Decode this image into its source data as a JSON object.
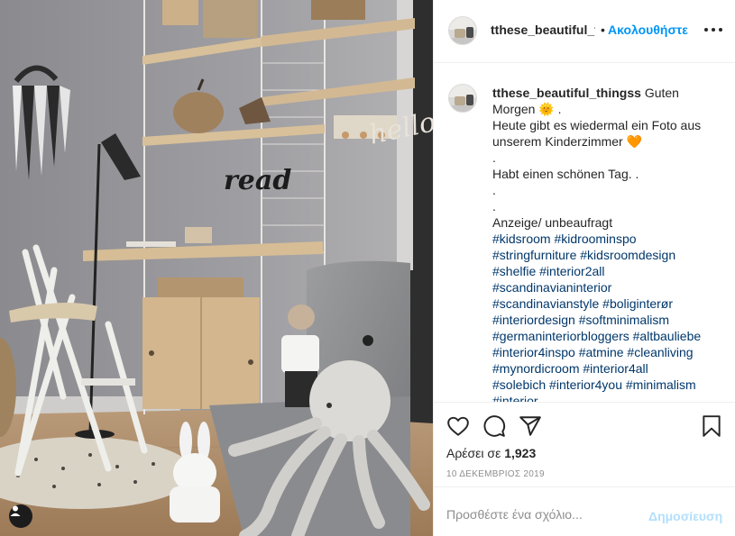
{
  "post": {
    "username": "tthese_beautiful_thingss",
    "header_username": "tthese_beautiful_tl",
    "header_separator": "•",
    "follow_label": "Ακολουθήστε",
    "caption_greeting": "Guten Morgen",
    "caption_lines": [
      "Morgen 🌞 .",
      "Heute gibt es wiedermal ein Foto aus",
      "unserem Kinderzimmer 🧡",
      ".",
      "Habt einen schönen Tag. .",
      ".",
      ".",
      "Anzeige/ unbeaufragt"
    ],
    "hashtag_lines": [
      "#kidsroom #kidroominspo",
      "#stringfurniture #kidsroomdesign",
      "#shelfie #interior2all",
      "#scandinavianinterior",
      "#scandinavianstyle #boliginterør",
      "#interiordesign #softminimalism",
      "#germaninteriorbloggers #altbauliebe",
      "#interior4inspo #atmine #cleanliving",
      "#mynordicroom #interior4all",
      "#solebich #interior4you #minimalism",
      "#interior"
    ],
    "likes_prefix": "Αρέσει σε",
    "likes_count": "1,923",
    "date": "10 ΔΕΚΕΜΒΡΙΟΣ 2019",
    "comment_placeholder": "Προσθέστε ένα σχόλιο...",
    "post_label": "Δημοσίευση"
  },
  "photo": {
    "wall_words": [
      "read",
      "hello"
    ]
  },
  "icons": {
    "like": "heart-icon",
    "comment": "comment-bubble-icon",
    "share": "paper-plane-icon",
    "save": "bookmark-icon",
    "more": "more-options-icon",
    "tag": "user-tag-icon"
  },
  "colors": {
    "link_blue": "#0095f6",
    "hashtag": "#00376b",
    "muted": "#8e8e8e",
    "post_disabled": "#b2dffc"
  }
}
